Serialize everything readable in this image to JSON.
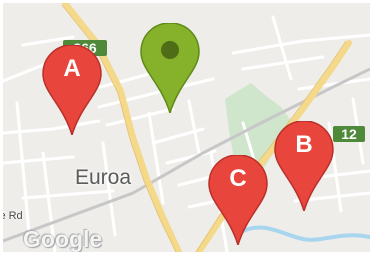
{
  "map": {
    "town_label": "Euroa",
    "street_label": "le Rd",
    "route_shields": [
      "266",
      "12"
    ],
    "brand_text": "Google",
    "colors": {
      "land": "#eeedea",
      "park": "#cfe6cc",
      "water": "#a9d6ef",
      "major_road": "#f5d98a",
      "minor_road": "#ffffff",
      "shield": "#4f8a3a"
    }
  },
  "markers": [
    {
      "label": "A",
      "color": "#e8453c"
    },
    {
      "label": "B",
      "color": "#e8453c"
    },
    {
      "label": "C",
      "color": "#e8453c"
    },
    {
      "label": "",
      "color": "#86b12a"
    }
  ]
}
